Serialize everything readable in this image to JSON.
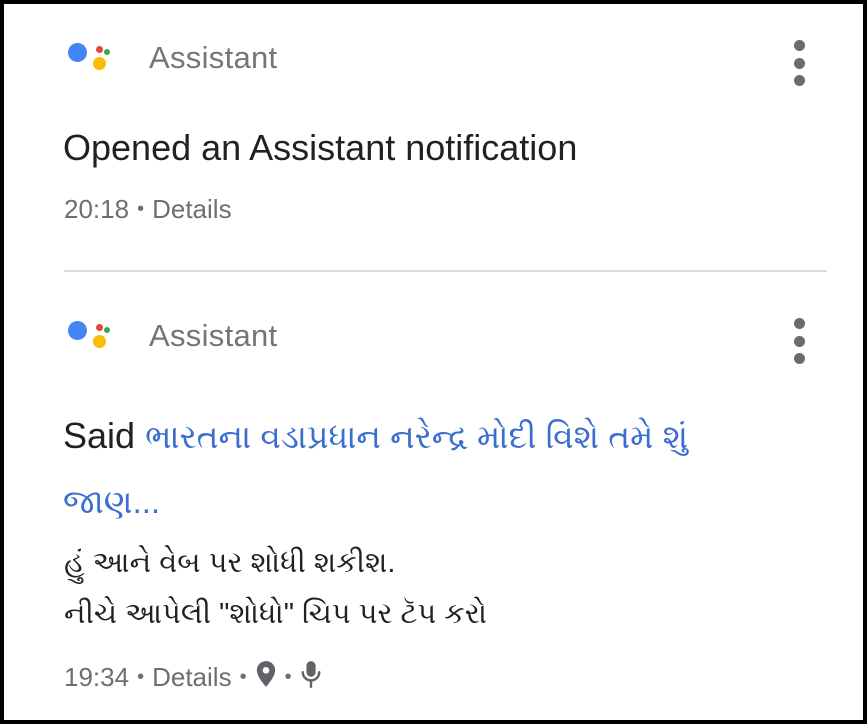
{
  "colors": {
    "assistant_blue": "#4285F4",
    "assistant_red": "#EA4335",
    "assistant_yellow": "#FBBC05",
    "assistant_green": "#34A853",
    "query_link": "#3c6ecf",
    "secondary_text": "#757575"
  },
  "cards": [
    {
      "app_name": "Assistant",
      "title": "Opened an Assistant notification",
      "time": "20:18",
      "details_label": "Details",
      "separator": "•"
    },
    {
      "app_name": "Assistant",
      "title_prefix": "Said",
      "query": "ભારતના વડાપ્રધાન નરેન્દ્ર મોદી વિશે તમે શું જાણ...",
      "response_lines": [
        "હું આને વેબ પર શોધી શકીશ.",
        "નીચે આપેલી \"શોધો\" ચિપ પર ટૅપ કરો"
      ],
      "time": "19:34",
      "details_label": "Details",
      "separator": "•",
      "icons": [
        "location-pin-icon",
        "microphone-icon"
      ]
    }
  ]
}
